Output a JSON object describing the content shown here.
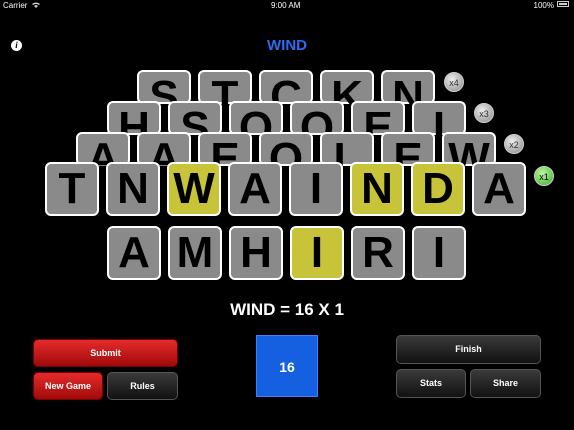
{
  "status": {
    "carrier": "Carrier",
    "time": "9:00 AM",
    "battery": "100%"
  },
  "title": "WIND",
  "rows": [
    {
      "letters": [
        "S",
        "T",
        "C",
        "K",
        "N"
      ],
      "multiplier": "x4"
    },
    {
      "letters": [
        "H",
        "S",
        "O",
        "O",
        "E",
        "I"
      ],
      "multiplier": "x3"
    },
    {
      "letters": [
        "A",
        "A",
        "E",
        "O",
        "L",
        "E",
        "W"
      ],
      "multiplier": "x2"
    },
    {
      "letters": [
        "T",
        "N",
        "W",
        "A",
        "I",
        "N",
        "D",
        "A"
      ],
      "multiplier": "x1"
    },
    {
      "letters": [
        "A",
        "M",
        "H",
        "I",
        "R",
        "I"
      ],
      "multiplier": ""
    }
  ],
  "highlighted": [
    [
      3,
      2
    ],
    [
      3,
      5
    ],
    [
      3,
      6
    ],
    [
      4,
      3
    ]
  ],
  "result": "WIND = 16 X 1",
  "score": "16",
  "buttons": {
    "submit": "Submit",
    "new_game": "New Game",
    "rules": "Rules",
    "finish": "Finish",
    "stats": "Stats",
    "share": "Share"
  },
  "colors": {
    "tile": "#8a8a8a",
    "highlight": "#c7c43a",
    "title": "#2a6cf0",
    "score_bg": "#1560e0",
    "red_button": "#c11a1a"
  }
}
